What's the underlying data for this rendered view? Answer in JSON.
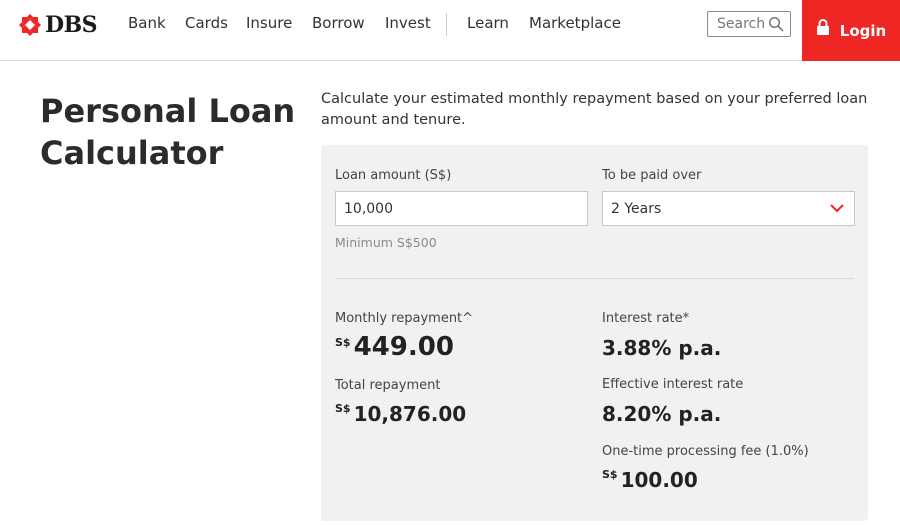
{
  "brand": {
    "name": "DBS",
    "color": "#ee2624"
  },
  "nav": {
    "items": [
      {
        "label": "Bank"
      },
      {
        "label": "Cards"
      },
      {
        "label": "Insure"
      },
      {
        "label": "Borrow"
      },
      {
        "label": "Invest"
      },
      {
        "label": "Learn"
      },
      {
        "label": "Marketplace"
      }
    ],
    "search_label": "Search",
    "search_icon": "search-icon",
    "login_label": "Login",
    "login_icon": "lock-icon"
  },
  "page": {
    "title": "Personal Loan Calculator",
    "intro": "Calculate your estimated monthly repayment based on your preferred loan amount and tenure."
  },
  "calculator": {
    "loan_amount_label": "Loan amount (S$)",
    "loan_amount_value": "10,000",
    "loan_amount_hint": "Minimum S$500",
    "tenure_label": "To be paid over",
    "tenure_value": "2 Years",
    "tenure_icon": "chevron-down-icon",
    "currency": "S$",
    "monthly_label": "Monthly repayment^",
    "monthly_value": "449.00",
    "total_label": "Total repayment",
    "total_value": "10,876.00",
    "interest_label": "Interest rate*",
    "interest_value": "3.88% p.a.",
    "eir_label": "Effective interest rate",
    "eir_value": "8.20% p.a.",
    "fee_label": "One-time processing fee (1.0%)",
    "fee_value": "100.00"
  }
}
